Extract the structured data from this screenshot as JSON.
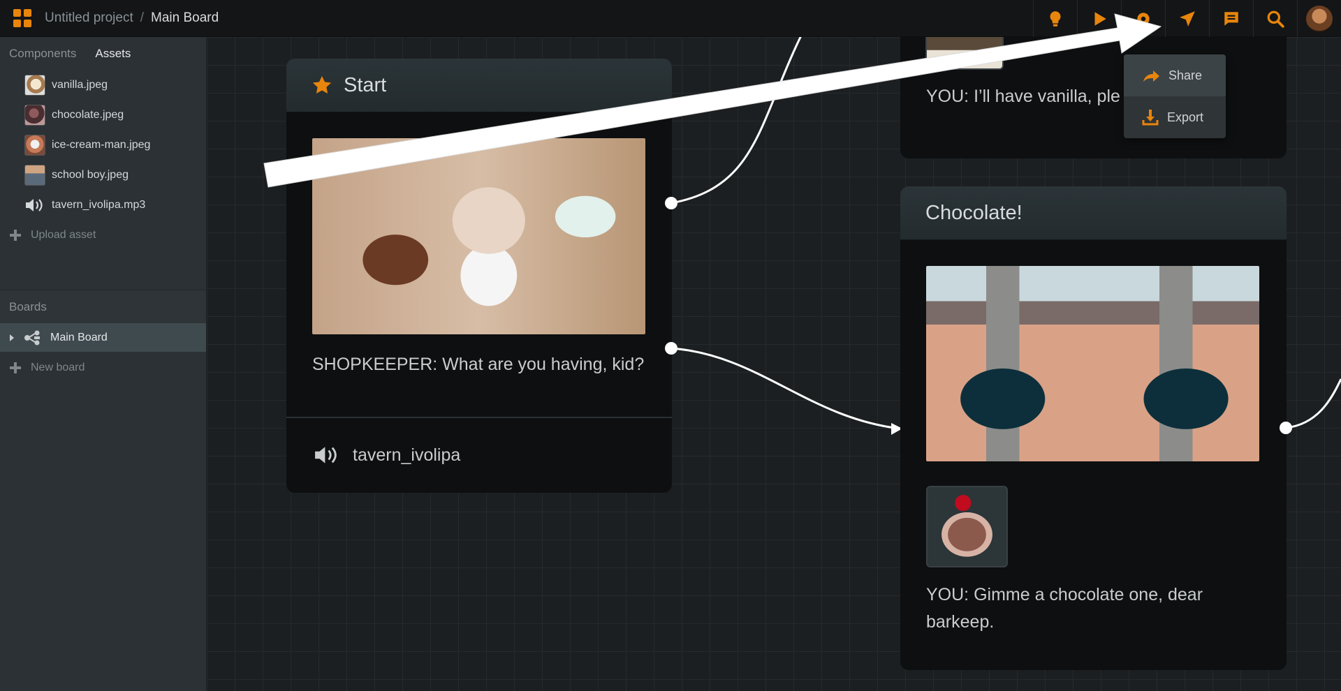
{
  "header": {
    "breadcrumb": {
      "project": "Untitled project",
      "separator": "/",
      "board": "Main Board"
    },
    "toolbar": [
      {
        "icon": "lightbulb-icon"
      },
      {
        "icon": "play-icon"
      },
      {
        "icon": "gear-icon"
      },
      {
        "icon": "send-icon"
      },
      {
        "icon": "comment-icon"
      },
      {
        "icon": "search-icon"
      }
    ],
    "accent_color": "#e8850c"
  },
  "sidebar": {
    "tabs": [
      {
        "label": "Components",
        "active": false
      },
      {
        "label": "Assets",
        "active": true
      }
    ],
    "assets": [
      {
        "name": "vanilla.jpeg",
        "icon": "image-thumbnail"
      },
      {
        "name": "chocolate.jpeg",
        "icon": "image-thumbnail"
      },
      {
        "name": "ice-cream-man.jpeg",
        "icon": "image-thumbnail"
      },
      {
        "name": "school boy.jpeg",
        "icon": "image-thumbnail"
      },
      {
        "name": "tavern_ivolipa.mp3",
        "icon": "sound-icon"
      }
    ],
    "upload_label": "Upload asset",
    "boards_heading": "Boards",
    "boards": [
      {
        "name": "Main Board",
        "selected": true
      }
    ],
    "new_board_label": "New board"
  },
  "canvas": {
    "start_card": {
      "title": "Start",
      "text": "SHOPKEEPER: What are you having, kid?",
      "audio": "tavern_ivolipa"
    },
    "vanilla_card": {
      "text": "YOU: I’ll have vanilla, ple"
    },
    "chocolate_card": {
      "title": "Chocolate!",
      "text": "YOU: Gimme a chocolate one, dear barkeep."
    }
  },
  "share_menu": {
    "items": [
      {
        "label": "Share",
        "icon": "share-icon"
      },
      {
        "label": "Export",
        "icon": "download-icon"
      }
    ]
  }
}
